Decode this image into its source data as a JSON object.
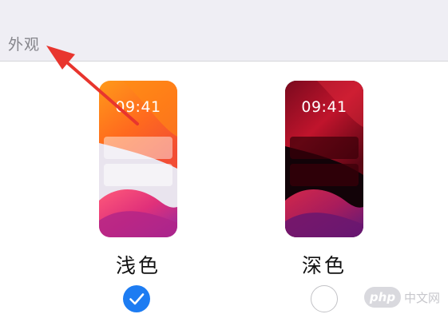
{
  "section": {
    "title": "外观"
  },
  "options": [
    {
      "label": "浅色",
      "time": "09:41",
      "selected": true
    },
    {
      "label": "深色",
      "time": "09:41",
      "selected": false
    }
  ],
  "watermark": {
    "logo_text": "php",
    "site_text": "中文网"
  },
  "colors": {
    "accent": "#1d7cf2",
    "annotation_arrow": "#e8352e",
    "header_background": "#efeef4"
  }
}
